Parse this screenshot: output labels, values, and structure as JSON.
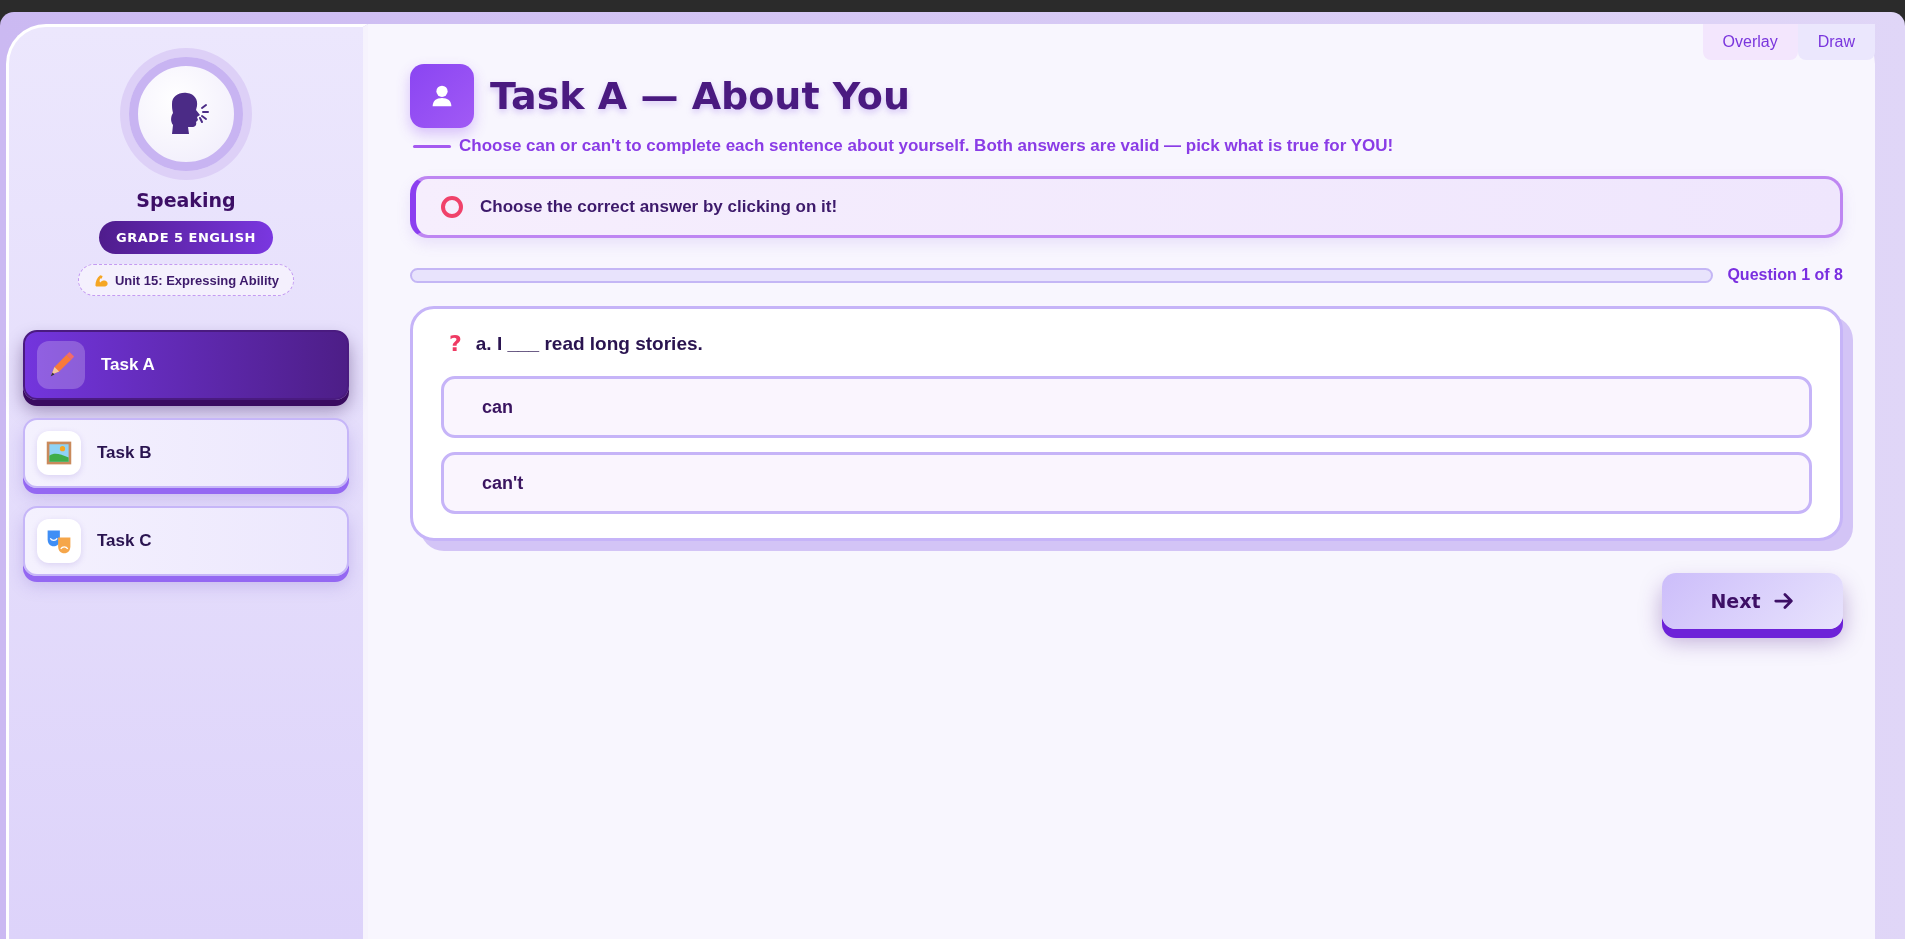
{
  "top_buttons": [
    "Overlay",
    "Draw"
  ],
  "sidebar": {
    "skill": "Speaking",
    "grade": "GRADE 5 ENGLISH",
    "unit": "Unit 15: Expressing Ability",
    "tasks": [
      {
        "label": "Task A",
        "kind": "pencil",
        "selected": true
      },
      {
        "label": "Task B",
        "kind": "picture",
        "selected": false
      },
      {
        "label": "Task C",
        "kind": "masks",
        "selected": false
      }
    ]
  },
  "header": {
    "title": "Task A — About You",
    "subtitle": "Choose can or can't to complete each sentence about yourself. Both answers are valid — pick what is true for YOU!"
  },
  "instruction": "Choose the correct answer by clicking on it!",
  "progress": {
    "level": 0,
    "label": "Question 1 of 8"
  },
  "question": {
    "marker": "?",
    "text": "a. I ___ read long stories.",
    "options": [
      {
        "label": "can",
        "selected": false
      },
      {
        "label": "can't",
        "selected": false
      }
    ]
  },
  "next_button": {
    "label": "Next"
  }
}
